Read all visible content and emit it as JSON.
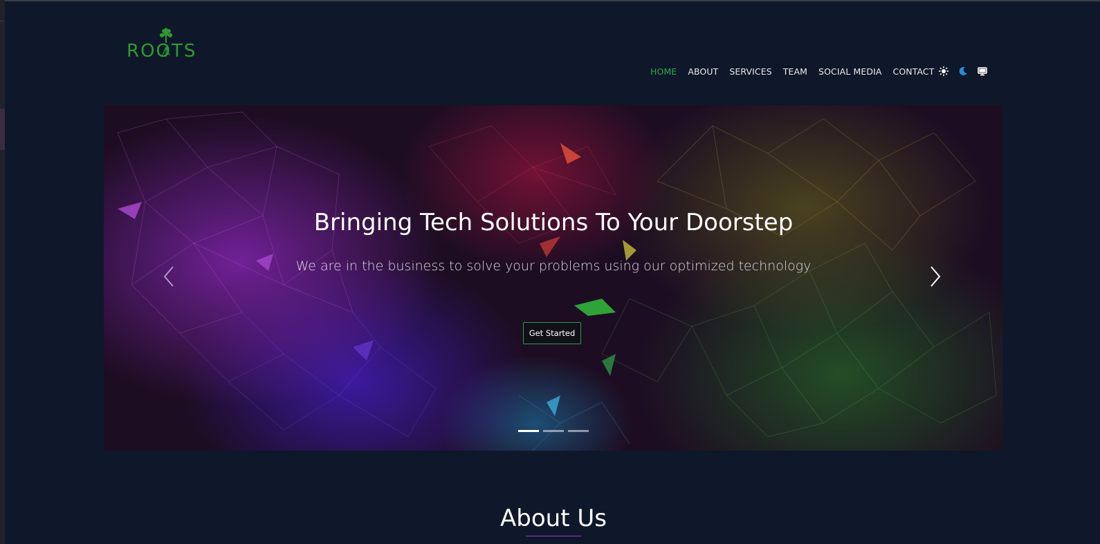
{
  "brand": {
    "logo_text": "ROOTS",
    "accent": "#2f9b2f"
  },
  "nav": {
    "items": [
      {
        "label": "HOME",
        "active": true
      },
      {
        "label": "ABOUT"
      },
      {
        "label": "SERVICES"
      },
      {
        "label": "TEAM"
      },
      {
        "label": "SOCIAL MEDIA"
      },
      {
        "label": "CONTACT"
      }
    ],
    "active_color": "#2fa84f",
    "theme_icons": [
      "sun-icon",
      "moon-icon",
      "monitor-icon"
    ]
  },
  "hero": {
    "title": "Bringing Tech Solutions To Your Doorstep",
    "subtitle": "We are in the business to solve your problems using our optimized technology",
    "cta_label": "Get Started",
    "slide_count": 3,
    "active_slide": 1
  },
  "about": {
    "title": "About Us",
    "underline_color": "#a23cc4"
  }
}
